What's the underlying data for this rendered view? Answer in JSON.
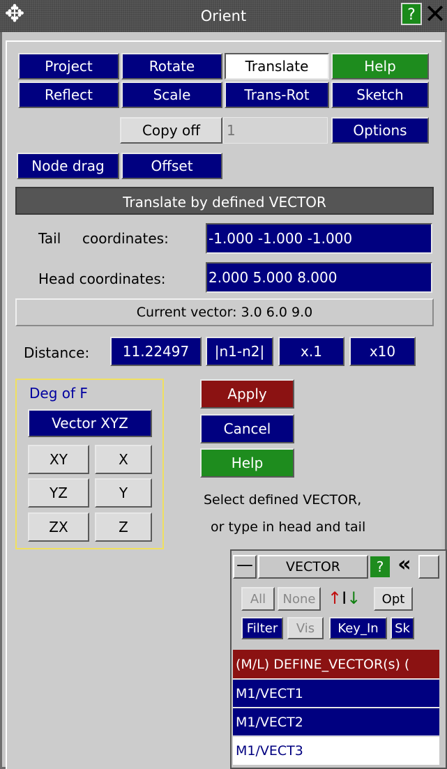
{
  "window": {
    "title": "Orient"
  },
  "tabs": {
    "project": "Project",
    "rotate": "Rotate",
    "translate": "Translate",
    "help": "Help",
    "reflect": "Reflect",
    "scale": "Scale",
    "trans_rot": "Trans-Rot",
    "sketch": "Sketch"
  },
  "copy": {
    "label": "Copy off",
    "count": "1",
    "options": "Options"
  },
  "modes": {
    "node_drag": "Node drag",
    "offset": "Offset"
  },
  "section_header": "Translate by defined VECTOR",
  "tail": {
    "label_a": "Tail",
    "label_b": "coordinates:",
    "value": "-1.000 -1.000 -1.000"
  },
  "head": {
    "label": "Head coordinates:",
    "value": "2.000 5.000 8.000"
  },
  "current_vector": "Current vector: 3.0  6.0  9.0",
  "distance": {
    "label": "Distance:",
    "value": "11.22497",
    "n1n2": "|n1-n2|",
    "x01": "x.1",
    "x10": "x10"
  },
  "dof": {
    "title": "Deg of F",
    "vector_xyz": "Vector XYZ",
    "xy": "XY",
    "x": "X",
    "yz": "YZ",
    "y": "Y",
    "zx": "ZX",
    "z": "Z"
  },
  "actions": {
    "apply": "Apply",
    "cancel": "Cancel",
    "help": "Help"
  },
  "hint": {
    "line1": "Select defined VECTOR,",
    "line2": "or type in head and tail"
  },
  "vector_panel": {
    "title": "VECTOR",
    "all": "All",
    "none": "None",
    "opt": "Opt",
    "filter": "Filter",
    "vis": "Vis",
    "key_in": "Key_In",
    "sk": "Sk",
    "header": "(M/L) DEFINE_VECTOR(s) (",
    "items": [
      "M1/VECT1",
      "M1/VECT2",
      "M1/VECT3"
    ]
  },
  "colors": {
    "navy": "#000080",
    "green": "#1e8c1e",
    "red": "#8b1212",
    "panel": "#c8c8c8"
  }
}
